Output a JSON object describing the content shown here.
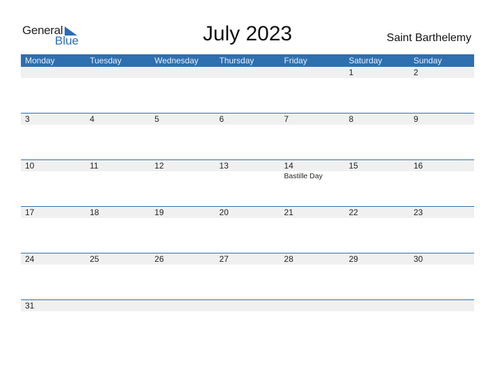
{
  "logo": {
    "line1": "General",
    "line2": "Blue"
  },
  "title": "July 2023",
  "country": "Saint Barthelemy",
  "colors": {
    "accent": "#2e6fb0",
    "band": "#f0f0f0"
  },
  "weekdays": [
    "Monday",
    "Tuesday",
    "Wednesday",
    "Thursday",
    "Friday",
    "Saturday",
    "Sunday"
  ],
  "weeks": [
    [
      {
        "d": ""
      },
      {
        "d": ""
      },
      {
        "d": ""
      },
      {
        "d": ""
      },
      {
        "d": ""
      },
      {
        "d": "1"
      },
      {
        "d": "2"
      }
    ],
    [
      {
        "d": "3"
      },
      {
        "d": "4"
      },
      {
        "d": "5"
      },
      {
        "d": "6"
      },
      {
        "d": "7"
      },
      {
        "d": "8"
      },
      {
        "d": "9"
      }
    ],
    [
      {
        "d": "10"
      },
      {
        "d": "11"
      },
      {
        "d": "12"
      },
      {
        "d": "13"
      },
      {
        "d": "14",
        "holiday": "Bastille Day"
      },
      {
        "d": "15"
      },
      {
        "d": "16"
      }
    ],
    [
      {
        "d": "17"
      },
      {
        "d": "18"
      },
      {
        "d": "19"
      },
      {
        "d": "20"
      },
      {
        "d": "21"
      },
      {
        "d": "22"
      },
      {
        "d": "23"
      }
    ],
    [
      {
        "d": "24"
      },
      {
        "d": "25"
      },
      {
        "d": "26"
      },
      {
        "d": "27"
      },
      {
        "d": "28"
      },
      {
        "d": "29"
      },
      {
        "d": "30"
      }
    ],
    [
      {
        "d": "31"
      },
      {
        "d": ""
      },
      {
        "d": ""
      },
      {
        "d": ""
      },
      {
        "d": ""
      },
      {
        "d": ""
      },
      {
        "d": ""
      }
    ]
  ]
}
